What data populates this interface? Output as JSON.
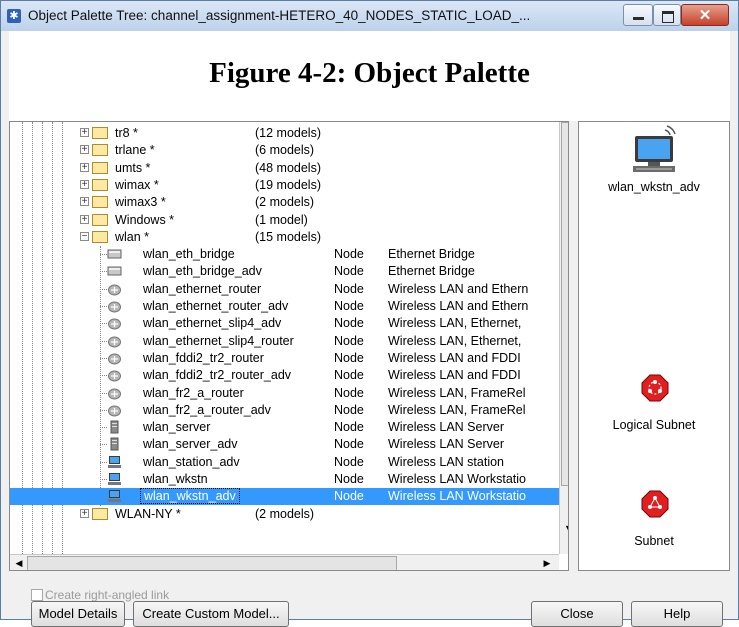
{
  "window": {
    "title": "Object Palette Tree: channel_assignment-HETERO_40_NODES_STATIC_LOAD_...",
    "close_glyph": "✕"
  },
  "page": {
    "figure_caption": "Figure 4-2: Object Palette"
  },
  "tree": {
    "folders": [
      {
        "name": "tr8 *",
        "count": "(12 models)",
        "expanded": false
      },
      {
        "name": "trlane *",
        "count": "(6 models)",
        "expanded": false
      },
      {
        "name": "umts *",
        "count": "(48 models)",
        "expanded": false
      },
      {
        "name": "wimax *",
        "count": "(19 models)",
        "expanded": false
      },
      {
        "name": "wimax3 *",
        "count": "(2 models)",
        "expanded": false
      },
      {
        "name": "Windows *",
        "count": "(1 model)",
        "expanded": false
      },
      {
        "name": "wlan *",
        "count": "(15 models)",
        "expanded": true
      }
    ],
    "items": [
      {
        "name": "wlan_eth_bridge",
        "type": "Node",
        "desc": "Ethernet Bridge",
        "icon": "bridge-icon"
      },
      {
        "name": "wlan_eth_bridge_adv",
        "type": "Node",
        "desc": "Ethernet Bridge",
        "icon": "bridge-icon"
      },
      {
        "name": "wlan_ethernet_router",
        "type": "Node",
        "desc": "Wireless LAN and Ethern",
        "icon": "router-icon"
      },
      {
        "name": "wlan_ethernet_router_adv",
        "type": "Node",
        "desc": "Wireless LAN and Ethern",
        "icon": "router-icon"
      },
      {
        "name": "wlan_ethernet_slip4_adv",
        "type": "Node",
        "desc": "Wireless LAN, Ethernet,",
        "icon": "router-icon"
      },
      {
        "name": "wlan_ethernet_slip4_router",
        "type": "Node",
        "desc": "Wireless LAN, Ethernet,",
        "icon": "router-icon"
      },
      {
        "name": "wlan_fddi2_tr2_router",
        "type": "Node",
        "desc": "Wireless LAN and FDDI",
        "icon": "router-icon"
      },
      {
        "name": "wlan_fddi2_tr2_router_adv",
        "type": "Node",
        "desc": "Wireless LAN and FDDI",
        "icon": "router-icon"
      },
      {
        "name": "wlan_fr2_a_router",
        "type": "Node",
        "desc": "Wireless LAN, FrameRel",
        "icon": "router-icon"
      },
      {
        "name": "wlan_fr2_a_router_adv",
        "type": "Node",
        "desc": "Wireless LAN, FrameRel",
        "icon": "router-icon"
      },
      {
        "name": "wlan_server",
        "type": "Node",
        "desc": "Wireless LAN Server",
        "icon": "server-icon"
      },
      {
        "name": "wlan_server_adv",
        "type": "Node",
        "desc": "Wireless LAN Server",
        "icon": "server-icon"
      },
      {
        "name": "wlan_station_adv",
        "type": "Node",
        "desc": "Wireless LAN station",
        "icon": "workstation-icon"
      },
      {
        "name": "wlan_wkstn",
        "type": "Node",
        "desc": "Wireless LAN Workstatio",
        "icon": "workstation-icon"
      }
    ],
    "selected": {
      "name": "wlan_wkstn_adv",
      "type": "Node",
      "desc": "Wireless LAN Workstatio"
    },
    "after_folder": {
      "name": "WLAN-NY *",
      "count": "(2 models)"
    }
  },
  "palette": {
    "items": [
      {
        "label": "wlan_wkstn_adv",
        "icon": "workstation-icon"
      },
      {
        "label": "Logical Subnet",
        "icon": "logical-subnet-icon"
      },
      {
        "label": "Subnet",
        "icon": "subnet-icon"
      }
    ]
  },
  "options": {
    "right_angled_link_label": "Create right-angled link",
    "right_angled_link_checked": false
  },
  "buttons": {
    "model_details": "Model Details",
    "create_custom_model": "Create Custom Model...",
    "close": "Close",
    "help": "Help"
  },
  "colors": {
    "selection": "#3399ff",
    "subnet_red": "#e02020",
    "folder_yellow": "#fde9a1"
  }
}
